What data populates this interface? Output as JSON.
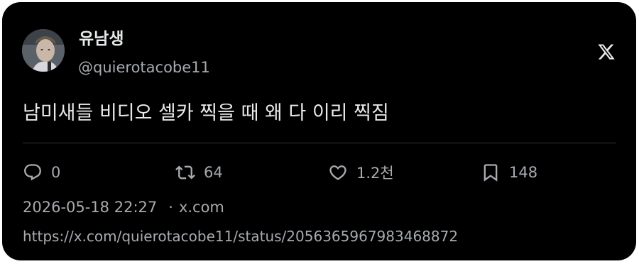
{
  "author": {
    "display_name": "유남생",
    "handle": "@quierotacobe11"
  },
  "platform": {
    "logo_icon": "x-logo-icon"
  },
  "tweet": {
    "text": "남미새들 비디오 셀카 찍을 때 왜 다 이리 찍짐"
  },
  "actions": {
    "replies": {
      "icon": "reply-icon",
      "count": "0"
    },
    "reposts": {
      "icon": "repost-icon",
      "count": "64"
    },
    "likes": {
      "icon": "heart-icon",
      "count": "1.2천"
    },
    "bookmarks": {
      "icon": "bookmark-icon",
      "count": "148"
    }
  },
  "meta": {
    "timestamp": "2026-05-18 22:27",
    "separator": "·",
    "source": "x.com",
    "url": "https://x.com/quierotacobe11/status/2056365967983468872"
  },
  "colors": {
    "background": "#000000",
    "text_primary": "#e7e9ea",
    "text_secondary": "#a7abb0",
    "divider": "#2f3336"
  }
}
